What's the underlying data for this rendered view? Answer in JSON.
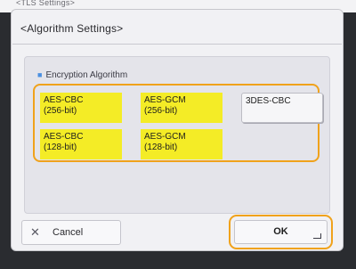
{
  "background": {
    "title": "<TLS Settings>"
  },
  "dialog": {
    "title": "<Algorithm Settings>",
    "section_label": "Encryption Algorithm",
    "options": [
      {
        "line1": "AES-CBC",
        "line2": "(256-bit)",
        "selected": true
      },
      {
        "line1": "AES-GCM",
        "line2": "(256-bit)",
        "selected": true
      },
      {
        "line1": "3DES-CBC",
        "line2": "",
        "selected": false
      },
      {
        "line1": "AES-CBC",
        "line2": "(128-bit)",
        "selected": true
      },
      {
        "line1": "AES-GCM",
        "line2": "(128-bit)",
        "selected": true
      }
    ],
    "cancel_label": "Cancel",
    "ok_label": "OK"
  },
  "colors": {
    "highlight_frame": "#f0a21b",
    "selected_fill": "#f4ec26",
    "bullet": "#4a8fe0"
  }
}
